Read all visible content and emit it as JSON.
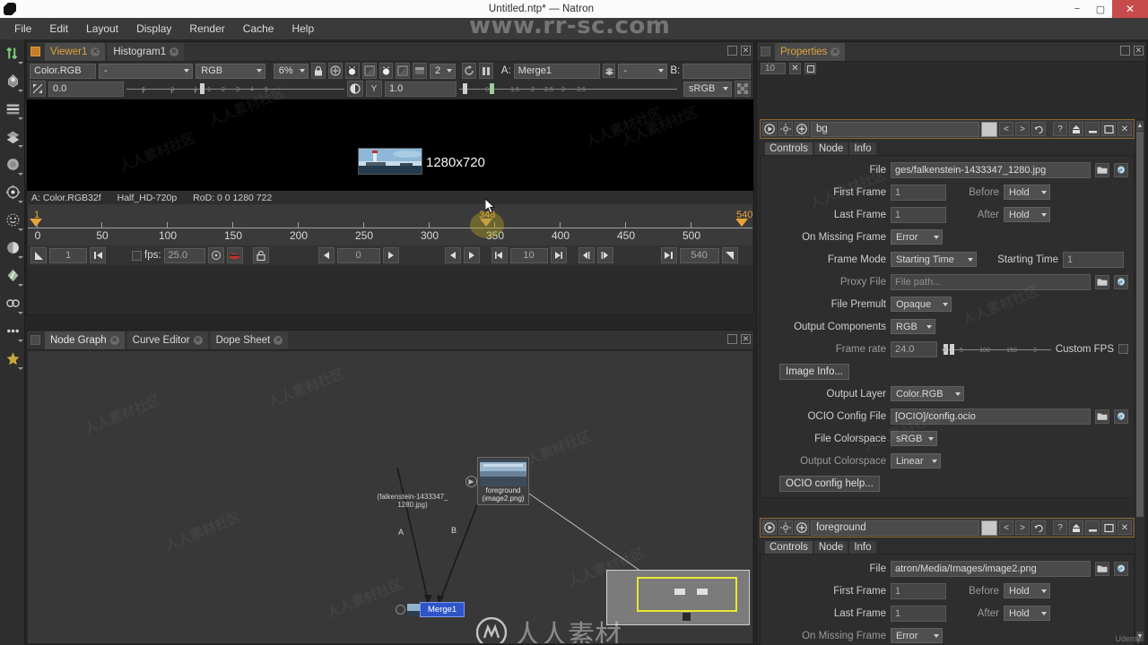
{
  "window": {
    "title": "Untitled.ntp* — Natron",
    "minimize": "−",
    "maximize": "▢",
    "close": "✕"
  },
  "watermarks": {
    "url": "www.rr-sc.com",
    "cn_small": "人人素材社区",
    "cn_big": "人人素材",
    "udemy": "Udemy"
  },
  "menu": {
    "items": [
      "File",
      "Edit",
      "Layout",
      "Display",
      "Render",
      "Cache",
      "Help"
    ]
  },
  "left_tools": [
    {
      "name": "image-tools",
      "glyph": "arrows"
    },
    {
      "name": "draw-tools",
      "glyph": "draw"
    },
    {
      "name": "time-tools",
      "glyph": "stack"
    },
    {
      "name": "channel-tools",
      "glyph": "layers"
    },
    {
      "name": "color-tools",
      "glyph": "gear-round"
    },
    {
      "name": "filter-tools",
      "glyph": "transform"
    },
    {
      "name": "keyer-tools",
      "glyph": "dashed"
    },
    {
      "name": "merge-tools",
      "glyph": "sphere"
    },
    {
      "name": "transform-tools",
      "glyph": "pen"
    },
    {
      "name": "views-tools",
      "glyph": "infinity"
    },
    {
      "name": "other-tools",
      "glyph": "dots"
    },
    {
      "name": "extra-tools",
      "glyph": "star"
    }
  ],
  "viewer": {
    "tabs": [
      {
        "label": "Viewer1",
        "selected": true
      },
      {
        "label": "Histogram1",
        "selected": false
      }
    ],
    "toolbar": {
      "layer": "Color.RGB",
      "alpha_channel": "-",
      "display_channels": "RGB",
      "zoom": "6%",
      "view_count": "2",
      "a_label": "A:",
      "a_input": "Merge1",
      "operation": "-",
      "b_label": "B:",
      "b_input": "",
      "gain_value": "0.0",
      "gamma_letter": "Y",
      "gamma_value": "1.0",
      "colorspace": "sRGB"
    },
    "image_size_label": "1280x720",
    "info": {
      "channel": "A: Color.RGB32f",
      "format": "Half_HD-720p",
      "rod": "RoD: 0 0 1280 722"
    },
    "timeline": {
      "current_frame_label": "1",
      "playhead_hover_label": "348",
      "end_label": "540",
      "ticks": [
        0,
        50,
        100,
        150,
        200,
        250,
        300,
        350,
        400,
        450,
        500
      ],
      "range_start": 0,
      "range_end": 560
    },
    "playbar": {
      "in_frame": "1",
      "fps_label": "fps:",
      "fps_value": "25.0",
      "frame_field": "0",
      "increment": "10",
      "out_frame": "540"
    }
  },
  "graph": {
    "tabs": [
      {
        "label": "Node Graph",
        "selected": true
      },
      {
        "label": "Curve Editor",
        "selected": false
      },
      {
        "label": "Dope Sheet",
        "selected": false
      }
    ],
    "nodes": [
      {
        "name": "bg",
        "sub1": "(falkenstein-1433347_",
        "sub2": "1280.jpg)"
      },
      {
        "name": "foreground",
        "sub1": "(image2.png)",
        "sub2": ""
      }
    ],
    "merge": {
      "label": "Merge1",
      "input_a": "A",
      "input_b": "B"
    }
  },
  "properties": {
    "tab_label": "Properties",
    "max_panels": "10",
    "panels": [
      {
        "node_name": "bg",
        "subtabs": [
          "Controls",
          "Node",
          "Info"
        ],
        "selected_subtab": "Controls",
        "fields": [
          {
            "label": "File",
            "value": "ges/falkenstein-1433347_1280.jpg",
            "type": "file"
          },
          {
            "label": "First Frame",
            "value": "1",
            "label2": "Before",
            "value2": "Hold",
            "type": "num-drop"
          },
          {
            "label": "Last Frame",
            "value": "1",
            "label2": "After",
            "value2": "Hold",
            "type": "num-drop"
          },
          {
            "label": "On Missing Frame",
            "value": "Error",
            "type": "drop"
          },
          {
            "label": "Frame Mode",
            "value": "Starting Time",
            "label2": "Starting Time",
            "value2": "1",
            "type": "drop-num"
          },
          {
            "label": "Proxy File",
            "value": "File path...",
            "type": "file-placeholder"
          },
          {
            "label": "File Premult",
            "value": "Opaque",
            "type": "drop"
          },
          {
            "label": "Output Components",
            "value": "RGB",
            "type": "drop"
          },
          {
            "label": "Frame rate",
            "value": "24.0",
            "label2": "Custom FPS",
            "type": "num-slider"
          },
          {
            "label": "",
            "value": "Image Info...",
            "type": "button"
          },
          {
            "label": "Output Layer",
            "value": "Color.RGB",
            "type": "drop"
          },
          {
            "label": "OCIO Config File",
            "value": "[OCIO]/config.ocio",
            "type": "file"
          },
          {
            "label": "File Colorspace",
            "value": "sRGB",
            "type": "drop"
          },
          {
            "label": "Output Colorspace",
            "value": "Linear",
            "type": "drop"
          },
          {
            "label": "",
            "value": "OCIO config help...",
            "type": "button"
          }
        ],
        "slider_ticks": [
          "0",
          "5",
          "100",
          "150",
          "3"
        ]
      },
      {
        "node_name": "foreground",
        "subtabs": [
          "Controls",
          "Node",
          "Info"
        ],
        "selected_subtab": "Controls",
        "fields": [
          {
            "label": "File",
            "value": "atron/Media/Images/image2.png",
            "type": "file"
          },
          {
            "label": "First Frame",
            "value": "1",
            "label2": "Before",
            "value2": "Hold",
            "type": "num-drop"
          },
          {
            "label": "Last Frame",
            "value": "1",
            "label2": "After",
            "value2": "Hold",
            "type": "num-drop"
          },
          {
            "label": "On Missing Frame",
            "value": "Error",
            "type": "drop"
          }
        ]
      }
    ]
  },
  "colors": {
    "accent_orange": "#e0a33c",
    "merge_blue": "#2f55c8",
    "selection_yellow": "#e8e832",
    "close_red": "#c84b4b",
    "panel_bg": "#2b2b2b"
  }
}
